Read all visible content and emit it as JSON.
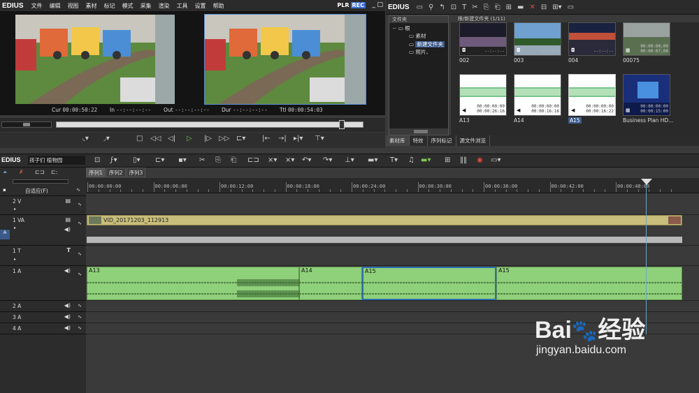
{
  "app": {
    "logo": "EDIUS"
  },
  "menu": [
    "文件",
    "编辑",
    "视图",
    "素材",
    "标记",
    "模式",
    "采集",
    "渲染",
    "工具",
    "设置",
    "帮助"
  ],
  "monitor": {
    "plr": "PLR",
    "rec": "REC",
    "timecodes": [
      {
        "label": "Cur",
        "value": "00:00:50:22"
      },
      {
        "label": "In",
        "value": "--:--:--:--"
      },
      {
        "label": "Out",
        "value": "--:--:--:--"
      },
      {
        "label": "Dur",
        "value": "--:--:--:--"
      },
      {
        "label": "Ttl",
        "value": "00:00:54:03"
      }
    ]
  },
  "bin": {
    "logo": "EDIUS",
    "folder_header": "文件夹",
    "path": "根/新建文件夹 (1/11)",
    "tree": [
      {
        "label": "根",
        "level": 0,
        "selected": false
      },
      {
        "label": "素材",
        "level": 1,
        "selected": false
      },
      {
        "label": "新建文件夹",
        "level": 1,
        "selected": true
      },
      {
        "label": "照片、",
        "level": 1,
        "selected": false
      }
    ],
    "clips": [
      {
        "label": "002",
        "tc1": "--:--:--",
        "tc2": "",
        "kind": "image",
        "selected": false
      },
      {
        "label": "003",
        "tc1": "--:--:--",
        "tc2": "",
        "kind": "image",
        "selected": false
      },
      {
        "label": "004",
        "tc1": "--:--:--",
        "tc2": "",
        "kind": "image",
        "selected": false
      },
      {
        "label": "00075",
        "tc1": "00:00:00;00",
        "tc2": "00:00:07;08",
        "kind": "video",
        "selected": false
      },
      {
        "label": "A13",
        "tc1": "00:00:00:00",
        "tc2": "00:00:26:16",
        "kind": "audio",
        "selected": false
      },
      {
        "label": "A14",
        "tc1": "00:00:00:00",
        "tc2": "00:00:16:16",
        "kind": "audio",
        "selected": false
      },
      {
        "label": "A15",
        "tc1": "00:00:00:00",
        "tc2": "00:00:16:22",
        "kind": "audio",
        "selected": true
      },
      {
        "label": "Business Plan HD...",
        "tc1": "00:00:00:00",
        "tc2": "00:00:15:00",
        "kind": "video",
        "selected": false
      }
    ],
    "tabs": [
      "素材库",
      "特效",
      "序列标记",
      "源文件浏览"
    ]
  },
  "timeline": {
    "logo": "EDIUS",
    "project": "孩子们 植物园",
    "sequences": [
      "序列1",
      "序列2",
      "序列3"
    ],
    "ruler": [
      "00:00:00:00",
      "00:00:06:00",
      "00:00:12:00",
      "00:00:18:00",
      "00:00:24:00",
      "00:00:30:00",
      "00:00:36:00",
      "00:00:42:00",
      "00:00:48:00"
    ],
    "adapt_label": "自适应(F)",
    "tracks": [
      {
        "name": "2 V"
      },
      {
        "name": "1 VA"
      },
      {
        "name": "1 T"
      },
      {
        "name": "1 A"
      },
      {
        "name": "2 A"
      },
      {
        "name": "3 A"
      },
      {
        "name": "4 A"
      }
    ],
    "video_clip": "VID_20171203_112913",
    "audio_clips": [
      "A13",
      "A14",
      "A15",
      "A15"
    ]
  },
  "watermark": {
    "brand": "Bai",
    "brand2": "经验",
    "url": "jingyan.baidu.com"
  },
  "colors": {
    "audio_clip": "#8fd07a",
    "video_clip": "#c8bd7a",
    "selected": "#3d5a8a",
    "rec": "#3a6ed6"
  }
}
